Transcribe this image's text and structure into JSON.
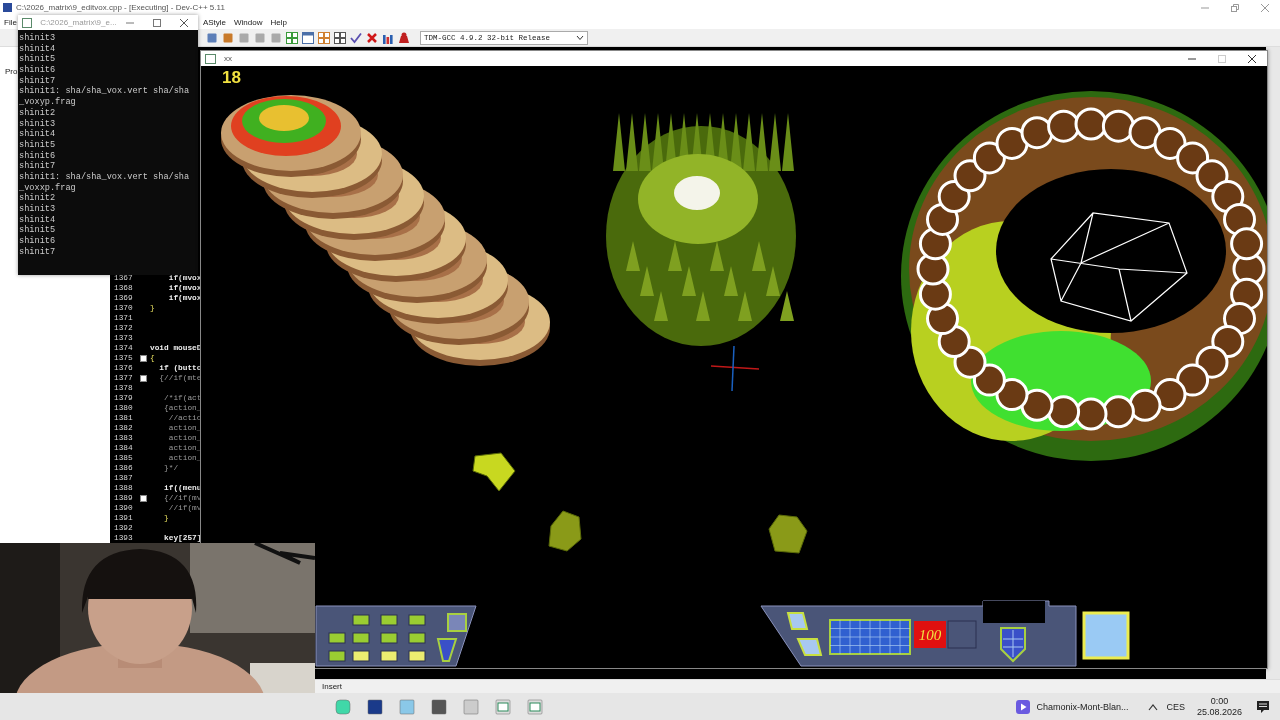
{
  "ide": {
    "title": "C:\\2026_matrix\\9_editvox.cpp - [Executing] - Dev-C++ 5.11",
    "menu": [
      "File",
      "AStyle",
      "Window",
      "Help"
    ],
    "side_tab": "Pro",
    "compiler": "TDM-GCC 4.9.2 32-bit Release",
    "editor": {
      "lines": [
        {
          "number": "1367",
          "code": "    if(mvox",
          "kind": "code",
          "fold": false
        },
        {
          "number": "1368",
          "code": "    if(mvox",
          "kind": "code",
          "fold": false
        },
        {
          "number": "1369",
          "code": "    if(mvox",
          "kind": "code",
          "fold": false
        },
        {
          "number": "1370",
          "code": "}",
          "kind": "brace",
          "fold": false
        },
        {
          "number": "1371",
          "fold": false
        },
        {
          "number": "1372",
          "fold": false
        },
        {
          "number": "1373",
          "fold": false
        },
        {
          "number": "1374",
          "code": "void mouseD",
          "kind": "code",
          "fold": false
        },
        {
          "number": "1375",
          "code": "{",
          "kind": "brace",
          "fold": true
        },
        {
          "number": "1376",
          "code": "  if (butto",
          "kind": "code",
          "fold": false
        },
        {
          "number": "1377",
          "code": "  {//if(mte",
          "kind": "comment",
          "fold": true
        },
        {
          "number": "1378",
          "fold": false
        },
        {
          "number": "1379",
          "code": "   /*if(act",
          "kind": "comment",
          "fold": false
        },
        {
          "number": "1380",
          "code": "   {action_",
          "kind": "comment",
          "fold": false
        },
        {
          "number": "1381",
          "code": "    //actio",
          "kind": "comment",
          "fold": false
        },
        {
          "number": "1382",
          "code": "    action_",
          "kind": "comment",
          "fold": false
        },
        {
          "number": "1383",
          "code": "    action_",
          "kind": "comment",
          "fold": false
        },
        {
          "number": "1384",
          "code": "    action_",
          "kind": "comment",
          "fold": false
        },
        {
          "number": "1385",
          "code": "    action_",
          "kind": "comment",
          "fold": false
        },
        {
          "number": "1386",
          "code": "   }*/",
          "kind": "comment",
          "fold": false
        },
        {
          "number": "1387",
          "fold": false
        },
        {
          "number": "1388",
          "code": "   if((menu",
          "kind": "code",
          "fold": false
        },
        {
          "number": "1389",
          "code": "   {//if(mv",
          "kind": "comment",
          "fold": true
        },
        {
          "number": "1390",
          "code": "    //if(mv",
          "kind": "comment",
          "fold": false
        },
        {
          "number": "1391",
          "code": "   }",
          "kind": "brace",
          "fold": false
        },
        {
          "number": "1392",
          "fold": false
        },
        {
          "number": "1393",
          "code": "   key[257]",
          "kind": "code",
          "fold": false
        }
      ]
    },
    "status_bar": "Insert"
  },
  "console": {
    "title": "C:\\2026_matrix\\9_e...",
    "lines": [
      "shinit3",
      "shinit4",
      "shinit5",
      "shinit6",
      "shinit7",
      "shinit1: sha/sha_vox.vert sha/sha",
      "_voxyp.frag",
      "shinit2",
      "shinit3",
      "shinit4",
      "shinit5",
      "shinit6",
      "shinit7",
      "shinit1: sha/sha_vox.vert sha/sha",
      "_voxxp.frag",
      "shinit2",
      "shinit3",
      "shinit4",
      "shinit5",
      "shinit6",
      "shinit7"
    ]
  },
  "game": {
    "title": "xx",
    "fps": "18",
    "hud_counter": "100"
  },
  "taskbar": {
    "media": "Chamonix-Mont-Blan...",
    "language": "CES",
    "time": "0:00",
    "date": "25.08.2026"
  }
}
